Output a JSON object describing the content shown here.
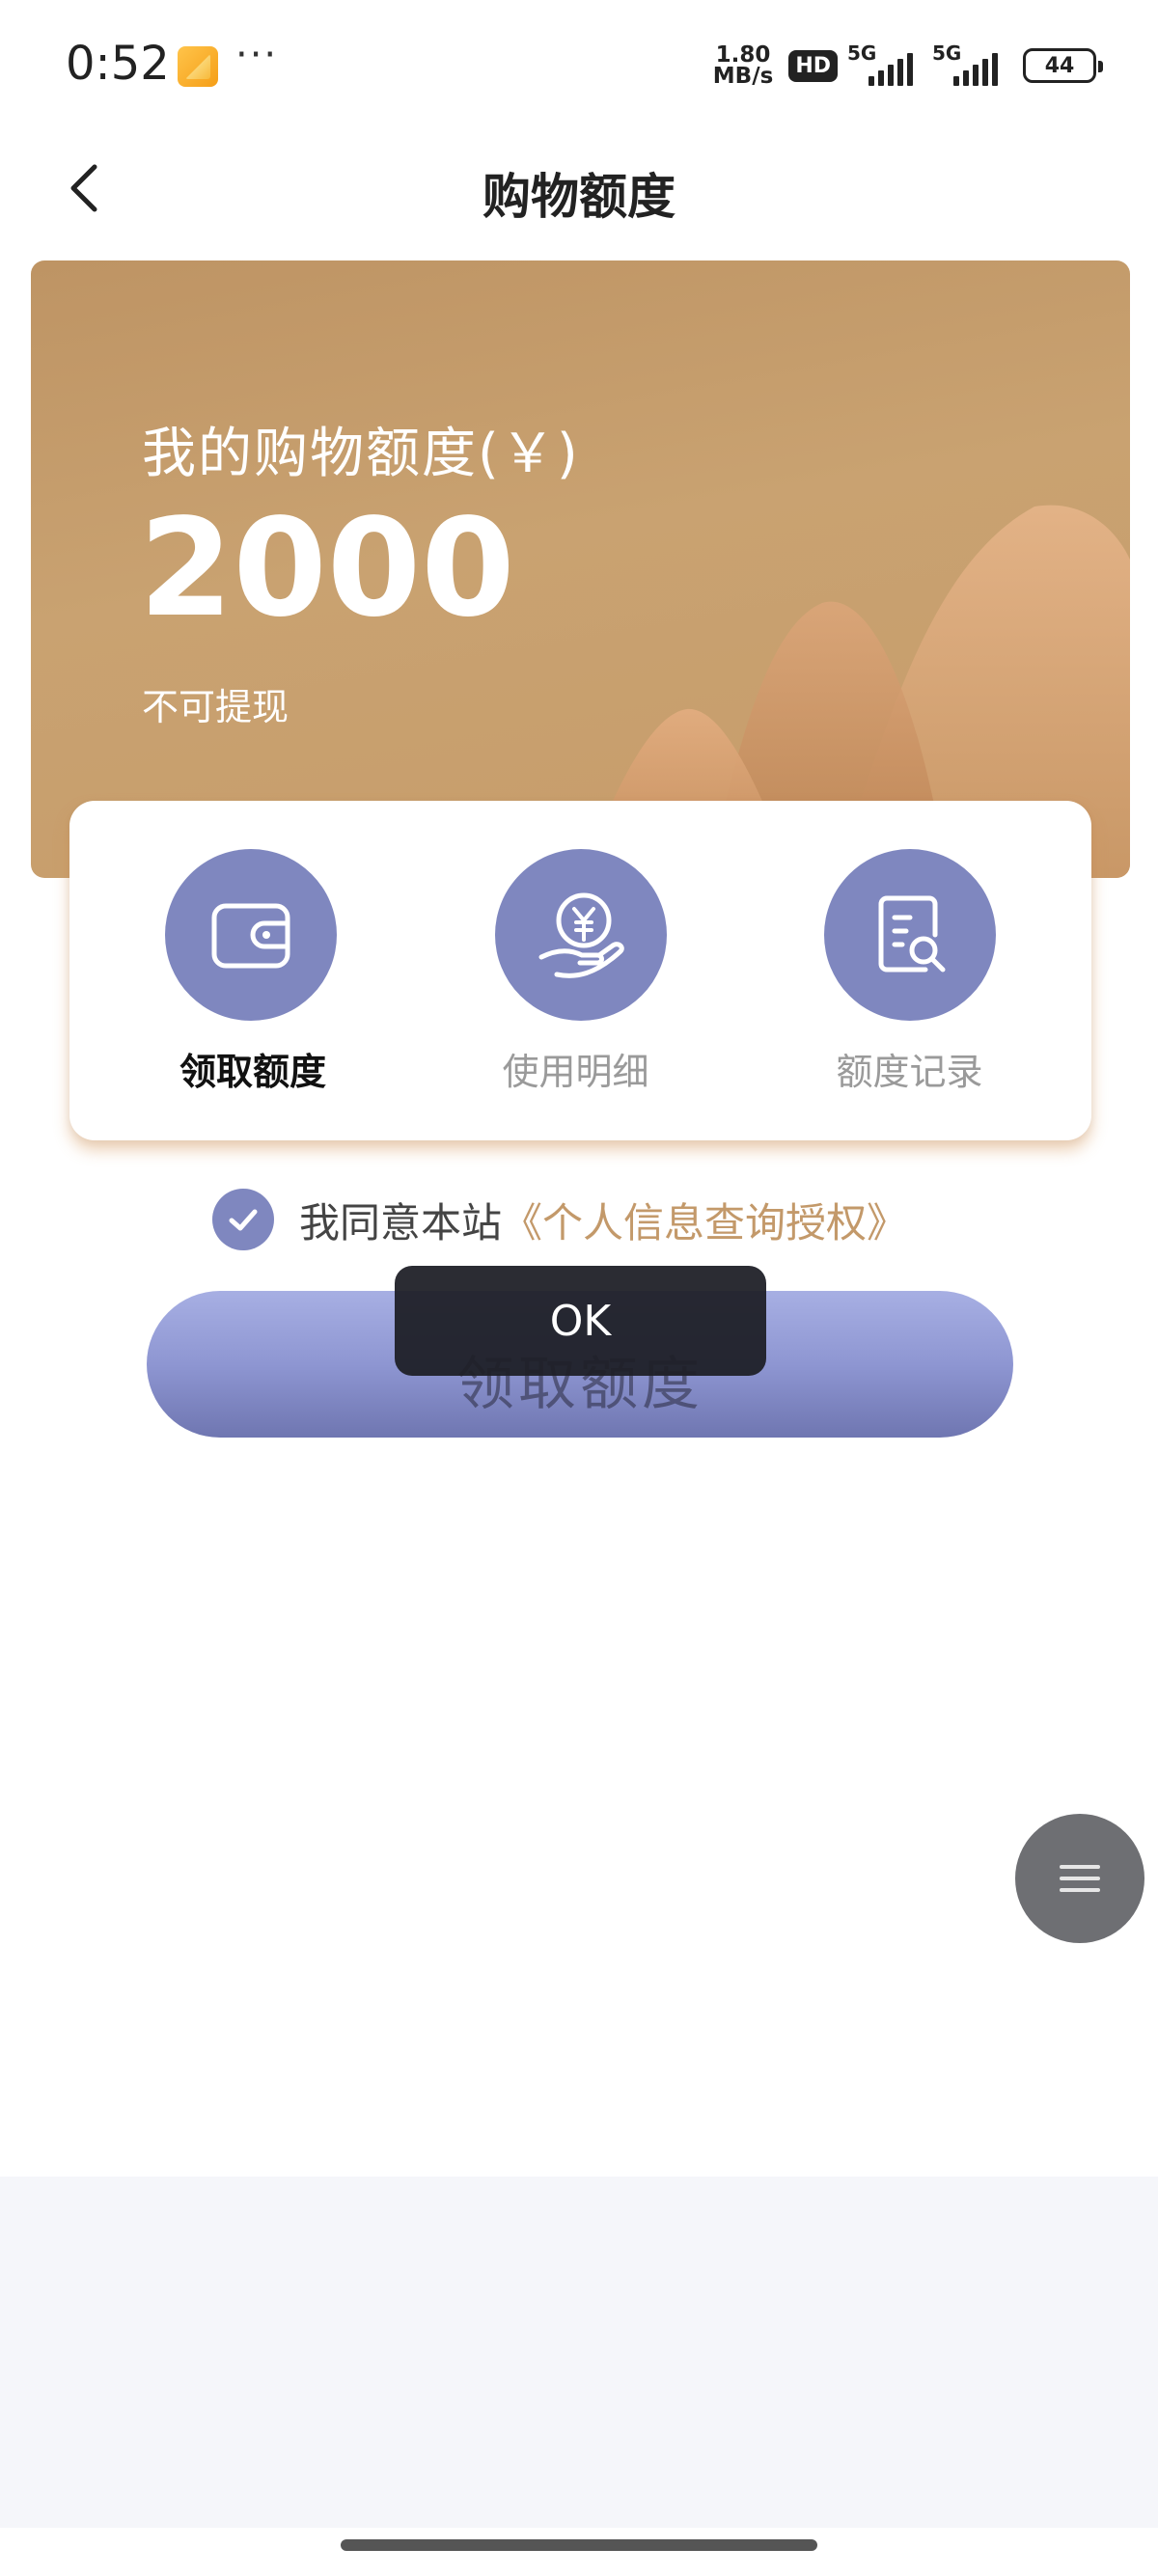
{
  "status_bar": {
    "time": "0:52",
    "app_icon": "notes-app-icon",
    "more": "···",
    "speed_value": "1.80",
    "speed_unit": "MB/s",
    "hd_badge": "HD",
    "sim1_label": "5G",
    "sim2_label": "5G",
    "battery": "44"
  },
  "nav": {
    "back_icon": "chevron-left-icon",
    "title": "购物额度"
  },
  "banner": {
    "label": "我的购物额度(￥)",
    "amount": "2000",
    "note": "不可提现"
  },
  "actions": [
    {
      "icon": "wallet-icon",
      "label": "领取额度",
      "active": true
    },
    {
      "icon": "yuan-hand-icon",
      "label": "使用明细",
      "active": false
    },
    {
      "icon": "document-search-icon",
      "label": "额度记录",
      "active": false
    }
  ],
  "agreement": {
    "checked": true,
    "text": "我同意本站",
    "link": "《个人信息查询授权》"
  },
  "claim_button": {
    "label": "领取额度"
  },
  "toast": {
    "text": "OK"
  },
  "float_menu": {
    "icon": "menu-icon"
  },
  "colors": {
    "accent": "#7f87bf",
    "banner": "#c49a6a",
    "link": "#c3996a",
    "toast": "#1e1f26",
    "float_menu": "#6e6f73"
  }
}
